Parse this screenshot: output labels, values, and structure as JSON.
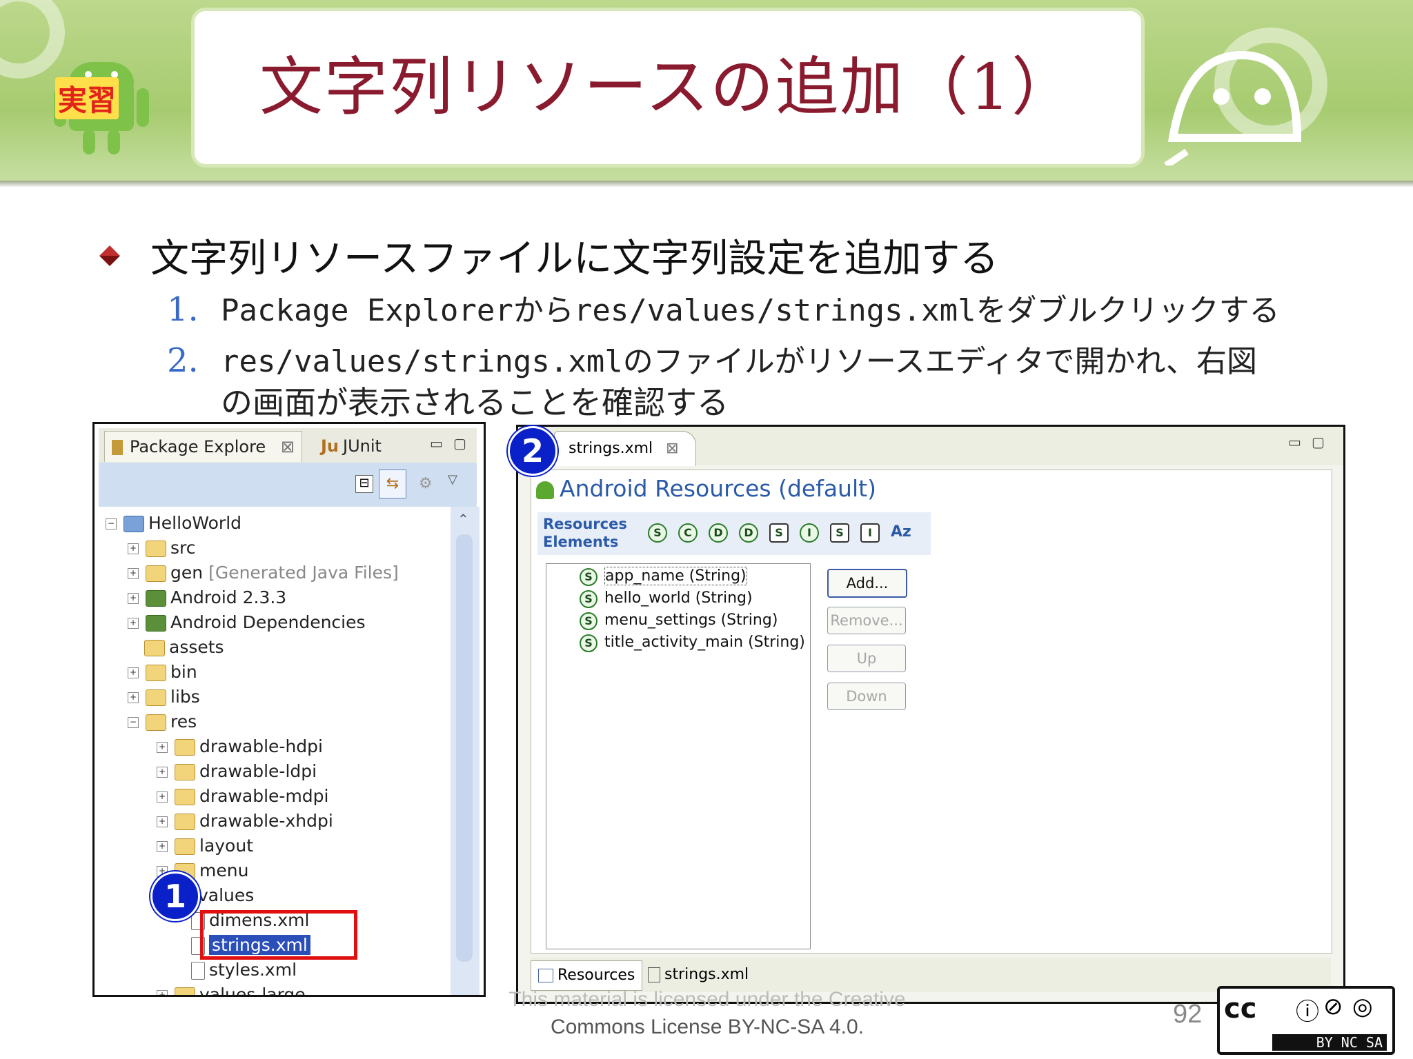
{
  "slide": {
    "badge": "実習",
    "title": "文字列リソースの追加（1）",
    "heading": "文字列リソースファイルに文字列設定を追加する",
    "steps": [
      {
        "num": "1.",
        "line1": "Package Explorerからres/values/strings.xmlをダブルクリックする"
      },
      {
        "num": "2.",
        "line1": "res/values/strings.xmlのファイルがリソースエディタで開かれ、右図",
        "line2": "の画面が表示されることを確認する"
      }
    ],
    "markers": [
      "1",
      "2"
    ]
  },
  "package_explorer": {
    "tab_label": "Package Explore",
    "tab2_label": "JUnit",
    "tree": [
      {
        "label": "HelloWorld",
        "hint": ""
      },
      {
        "label": "src",
        "hint": ""
      },
      {
        "label": "gen",
        "hint": "[Generated Java Files]"
      },
      {
        "label": "Android 2.3.3",
        "hint": ""
      },
      {
        "label": "Android Dependencies",
        "hint": ""
      },
      {
        "label": "assets",
        "hint": ""
      },
      {
        "label": "bin",
        "hint": ""
      },
      {
        "label": "libs",
        "hint": ""
      },
      {
        "label": "res",
        "hint": ""
      },
      {
        "label": "drawable-hdpi",
        "hint": ""
      },
      {
        "label": "drawable-ldpi",
        "hint": ""
      },
      {
        "label": "drawable-mdpi",
        "hint": ""
      },
      {
        "label": "drawable-xhdpi",
        "hint": ""
      },
      {
        "label": "layout",
        "hint": ""
      },
      {
        "label": "menu",
        "hint": ""
      },
      {
        "label": "values",
        "hint": ""
      },
      {
        "label": "dimens.xml",
        "hint": ""
      },
      {
        "label": "strings.xml",
        "hint": ""
      },
      {
        "label": "styles.xml",
        "hint": ""
      },
      {
        "label": "values-large",
        "hint": ""
      }
    ]
  },
  "editor": {
    "tab_label": "strings.xml",
    "heading": "Android Resources (default)",
    "resources_label_1": "Resources",
    "resources_label_2": "Elements",
    "toolbar_icons": [
      "S",
      "C",
      "D",
      "D",
      "S",
      "I",
      "S",
      "I",
      "Az"
    ],
    "items": [
      "app_name (String)",
      "hello_world (String)",
      "menu_settings (String)",
      "title_activity_main (String)"
    ],
    "buttons": {
      "add": "Add...",
      "remove": "Remove...",
      "up": "Up",
      "down": "Down"
    },
    "bottom_tabs": [
      "Resources",
      "strings.xml"
    ]
  },
  "footer": {
    "license_line1": "This material is licensed under the Creative",
    "license_line2": "Commons License BY-NC-SA 4.0.",
    "page_number": "92",
    "cc_top": "cc",
    "cc_bottom": "BY NC SA"
  },
  "colors": {
    "title": "#8a1a2e",
    "banner": "#a7cb70",
    "step_number": "#3a6ac8",
    "marker": "#0a20c8",
    "highlight": "#e01010"
  }
}
